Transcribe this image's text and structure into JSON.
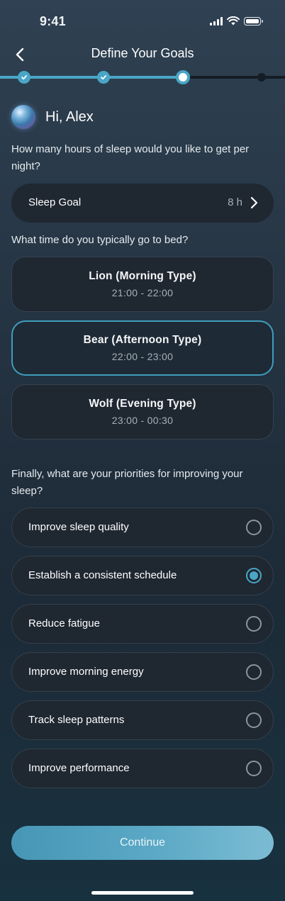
{
  "status_bar": {
    "time": "9:41"
  },
  "header": {
    "title": "Define Your Goals"
  },
  "progress": {
    "total_steps": 4,
    "completed_steps": 2,
    "current_step": 3
  },
  "greeting": {
    "text": "Hi, Alex"
  },
  "sleep_hours": {
    "question": "How many hours of sleep would you like to get per night?",
    "label": "Sleep Goal",
    "value": "8 h"
  },
  "bedtime": {
    "question": "What time do you typically go to bed?",
    "options": [
      {
        "title": "Lion (Morning Type)",
        "time": "21:00 - 22:00",
        "selected": false
      },
      {
        "title": "Bear (Afternoon Type)",
        "time": "22:00 - 23:00",
        "selected": true
      },
      {
        "title": "Wolf (Evening Type)",
        "time": "23:00 - 00:30",
        "selected": false
      }
    ]
  },
  "priorities": {
    "question": "Finally, what are your priorities for improving your sleep?",
    "options": [
      {
        "label": "Improve sleep quality",
        "selected": false
      },
      {
        "label": "Establish a consistent schedule",
        "selected": true
      },
      {
        "label": "Reduce fatigue",
        "selected": false
      },
      {
        "label": "Improve morning energy",
        "selected": false
      },
      {
        "label": "Track sleep patterns",
        "selected": false
      },
      {
        "label": "Improve performance",
        "selected": false
      }
    ]
  },
  "footer": {
    "continue_label": "Continue"
  },
  "colors": {
    "accent": "#4aa6c6",
    "card": "#1f2731",
    "background": "#253443"
  }
}
